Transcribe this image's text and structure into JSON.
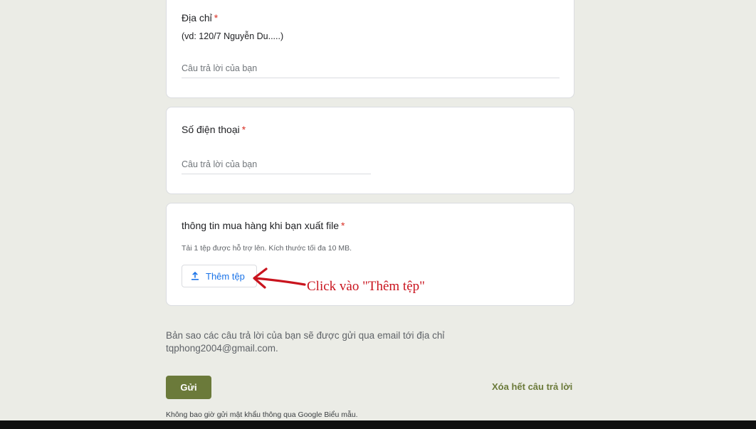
{
  "questions": [
    {
      "title": "Địa chỉ",
      "required_mark": "*",
      "description": "(vd: 120/7 Nguyễn Du.....)",
      "placeholder": "Câu trả lời của bạn"
    },
    {
      "title": "Số điện thoại",
      "required_mark": "*",
      "placeholder": "Câu trả lời của bạn"
    },
    {
      "title": "thông tin mua hàng khi bạn xuất file",
      "required_mark": "*",
      "hint": "Tải 1 tệp được hỗ trợ lên. Kích thước tối đa 10 MB.",
      "upload_label": "Thêm tệp",
      "upload_icon": "upload-icon"
    }
  ],
  "annotation": {
    "text": "Click vào \"Thêm tệp\"",
    "color": "#c9141e"
  },
  "email_note": "Bản sao các câu trả lời của bạn sẽ được gửi qua email tới địa chỉ tqphong2004@gmail.com.",
  "actions": {
    "submit_label": "Gửi",
    "clear_label": "Xóa hết câu trả lời"
  },
  "footer_note": "Không bao giờ gửi mật khẩu thông qua Google Biểu mẫu.",
  "theme": {
    "background": "#ebece6",
    "accent": "#6b7a3a",
    "link_blue": "#1a73e8",
    "required_red": "#d93025"
  }
}
